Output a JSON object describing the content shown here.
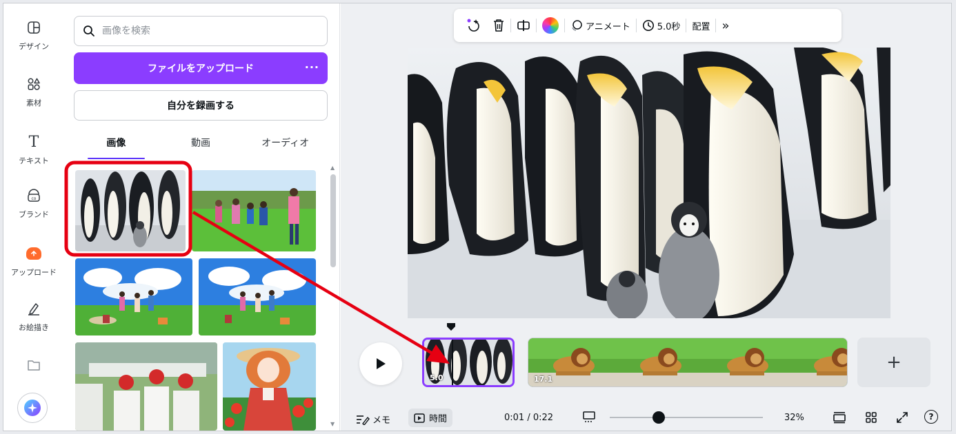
{
  "rail": {
    "items": [
      {
        "label": "デザイン",
        "icon": "layout-icon"
      },
      {
        "label": "素材",
        "icon": "elements-icon"
      },
      {
        "label": "テキスト",
        "icon": "text-icon"
      },
      {
        "label": "ブランド",
        "icon": "brand-icon"
      },
      {
        "label": "アップロード",
        "icon": "upload-icon"
      },
      {
        "label": "お絵描き",
        "icon": "draw-icon"
      },
      {
        "label": "",
        "icon": "folder-icon"
      }
    ]
  },
  "panel": {
    "search_placeholder": "画像を検索",
    "upload_label": "ファイルをアップロード",
    "upload_more": "···",
    "record_label": "自分を録画する",
    "tabs": [
      {
        "label": "画像",
        "active": true
      },
      {
        "label": "動画",
        "active": false
      },
      {
        "label": "オーディオ",
        "active": false
      }
    ]
  },
  "toolbar": {
    "animate_label": "アニメート",
    "duration_label": "5.0秒",
    "arrange_label": "配置",
    "more_label": "»"
  },
  "timeline": {
    "clip1_duration": "5.0",
    "clip2_duration": "17.1",
    "add_label": "+"
  },
  "bottom": {
    "notes_label": "メモ",
    "timer_label": "時間",
    "time_readout": "0:01 / 0:22",
    "zoom": "32%",
    "help": "?"
  },
  "colors": {
    "accent": "#8b3dff",
    "annotation": "#e60012"
  }
}
